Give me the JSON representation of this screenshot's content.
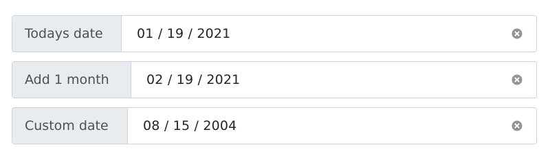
{
  "rows": [
    {
      "label": "Todays date",
      "value": "01 / 19 / 2021"
    },
    {
      "label": "Add 1 month",
      "value": "02 / 19 / 2021"
    },
    {
      "label": "Custom date",
      "value": "08 / 15 / 2004"
    }
  ],
  "icons": {
    "clear": "clear-circle-x-icon"
  },
  "colors": {
    "addon_bg": "#e9ecef",
    "border": "#ced4da",
    "clear_icon": "#8f959b"
  }
}
